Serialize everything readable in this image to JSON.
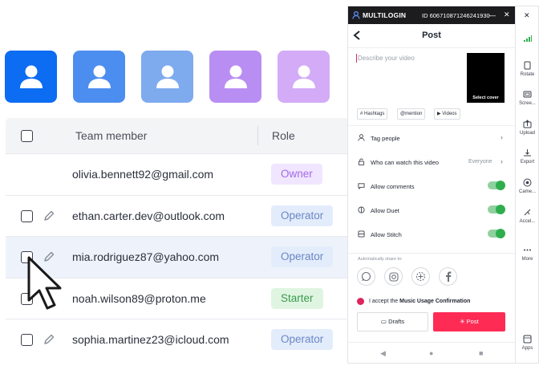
{
  "colors": {
    "avatar_tiles": [
      "#0c6cf2",
      "#4c8ef0",
      "#7eaaee",
      "#b98ef3",
      "#d3abf7"
    ],
    "accent_red": "#fe2c55",
    "toggle_green": "#2fae4d"
  },
  "team_table": {
    "header": {
      "member": "Team member",
      "role": "Role"
    },
    "rows": [
      {
        "email": "olivia.bennett92@gmail.com",
        "role": "Owner",
        "role_type": "owner",
        "editable": false
      },
      {
        "email": "ethan.carter.dev@outlook.com",
        "role": "Operator",
        "role_type": "operator",
        "editable": true
      },
      {
        "email": "mia.rodriguez87@yahoo.com",
        "role": "Operator",
        "role_type": "operator",
        "editable": true
      },
      {
        "email": "noah.wilson89@proton.me",
        "role": "Starter",
        "role_type": "starter",
        "editable": false
      },
      {
        "email": "sophia.martinez23@icloud.com",
        "role": "Operator",
        "role_type": "operator",
        "editable": true
      }
    ]
  },
  "phone": {
    "app_name": "MULTILOGIN",
    "profile_id": "ID 606710871246241930",
    "page_title": "Post",
    "description_placeholder": "Describe your video",
    "cover_label": "Select cover",
    "chips": [
      "# Hashtags",
      "@mention",
      "▶ Videos"
    ],
    "settings": [
      {
        "label": "Tag people",
        "type": "link",
        "value": ""
      },
      {
        "label": "Who can watch this video",
        "type": "link",
        "value": "Everyone"
      },
      {
        "label": "Allow comments",
        "type": "toggle",
        "value": ""
      },
      {
        "label": "Allow Duet",
        "type": "toggle",
        "value": ""
      },
      {
        "label": "Allow Stitch",
        "type": "toggle",
        "value": ""
      }
    ],
    "share_label": "Automatically share to:",
    "share_targets": [
      "whatsapp-icon",
      "instagram-icon",
      "other-share-icon",
      "facebook-icon"
    ],
    "accept_prefix": "I accept the ",
    "accept_link": "Music Usage Confirmation",
    "drafts_label": "Drafts",
    "post_label": "Post"
  },
  "sidebar": {
    "items": [
      {
        "label": "Rotate",
        "icon": "rotate-icon"
      },
      {
        "label": "Scree...",
        "icon": "screenshot-icon"
      },
      {
        "label": "Upload",
        "icon": "upload-icon"
      },
      {
        "label": "Export",
        "icon": "export-icon"
      },
      {
        "label": "Came...",
        "icon": "camera-icon"
      },
      {
        "label": "Accel...",
        "icon": "accelerometer-icon"
      },
      {
        "label": "More",
        "icon": "more-icon"
      },
      {
        "label": "Apps",
        "icon": "apps-icon"
      }
    ]
  }
}
